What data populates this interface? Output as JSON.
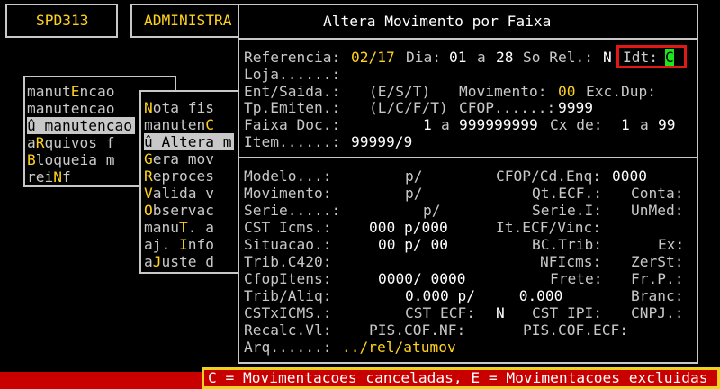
{
  "top_boxes": {
    "program": "SPD313",
    "menu_title": "ADMINISTRA"
  },
  "menu1": {
    "items": [
      {
        "pre": "manut",
        "hot": "E",
        "post": "ncao"
      },
      {
        "pre": "manutencao",
        "hot": "",
        "post": ""
      },
      {
        "pre": "û manutencao",
        "hot": "",
        "post": "",
        "selected": true
      },
      {
        "pre": "a",
        "hot": "R",
        "post": "quivos f"
      },
      {
        "pre": "",
        "hot": "B",
        "post": "loqueia m"
      },
      {
        "pre": "rei",
        "hot": "N",
        "post": "f"
      }
    ]
  },
  "menu2": {
    "items": [
      {
        "pre": "",
        "hot": "N",
        "post": "ota fis"
      },
      {
        "pre": "manuten",
        "hot": "C",
        "post": ""
      },
      {
        "pre": "û Altera m",
        "hot": "",
        "post": "",
        "selected": true
      },
      {
        "pre": "",
        "hot": "G",
        "post": "era mov"
      },
      {
        "pre": "",
        "hot": "R",
        "post": "eproces"
      },
      {
        "pre": "",
        "hot": "V",
        "post": "alida v"
      },
      {
        "pre": "",
        "hot": "O",
        "post": "bservac"
      },
      {
        "pre": "manu",
        "hot": "T",
        "post": ". a"
      },
      {
        "pre": "aj. ",
        "hot": "I",
        "post": "nfo"
      },
      {
        "pre": "a",
        "hot": "J",
        "post": "uste d"
      }
    ]
  },
  "dialog": {
    "title": "Altera Movimento por Faixa",
    "referencia_label": "Referencia:",
    "referencia_value": "02/17",
    "dia_label": "Dia:",
    "dia_from": "01",
    "a1": "a",
    "dia_to": "28",
    "so_rel_label": "So Rel.:",
    "so_rel_value": "N",
    "idt_label": "Idt:",
    "idt_value": "C",
    "loja_label": "Loja......:",
    "ent_saida_label": "Ent/Saida.:",
    "ent_saida_hint": "(E/S/T)",
    "movimento_label": "Movimento:",
    "movimento_value": "00",
    "exc_dup_label": "Exc.Dup:",
    "tp_emiten_label": "Tp.Emiten.:",
    "tp_emiten_hint": "(L/C/F/T)",
    "cfop_label": "CFOP......:",
    "cfop_value": "9999",
    "faixa_doc_label": "Faixa Doc.:",
    "faixa_from": "1",
    "a2": "a",
    "faixa_to": "999999999",
    "cx_de_label": "Cx de:",
    "cx_from": "1",
    "a3": "a",
    "cx_to": "99",
    "item_label": "Item......:",
    "item_value": "99999/9",
    "lower": {
      "modelo_label": "Modelo...:",
      "modelo_value": "p/",
      "cfop_cd_enq_label": "CFOP/Cd.Enq:",
      "cfop_cd_enq_value": "0000",
      "movimento_label": "Movimento:",
      "movimento_value": "p/",
      "qt_ecf_label": "Qt.ECF.:",
      "conta_label": "Conta:",
      "serie_label": "Serie.....:",
      "serie_value": "p/",
      "serie_i_label": "Serie.I:",
      "unmed_label": "UnMed:",
      "cst_icms_label": "CST Icms.:",
      "cst_icms_value": "000 p/000",
      "it_ecf_vinc_label": "It.ECF/Vinc:",
      "situacao_label": "Situacao.:",
      "situacao_value": "00 p/ 00",
      "bc_trib_label": "BC.Trib:",
      "ex_label": "Ex:",
      "trib_c420_label": "Trib.C420:",
      "nficms_label": "NFIcms:",
      "zerst_label": "ZerSt:",
      "cfopitens_label": "CfopItens:",
      "cfopitens_value": "0000/ 0000",
      "frete_label": "Frete:",
      "frp_label": "Fr.P.:",
      "trib_aliq_label": "Trib/Aliq:",
      "trib_aliq_value": "0.000 p/     0.000",
      "branc_label": "Branc:",
      "cstxicms_label": "CSTxICMS.:",
      "cst_ecf_label": "CST ECF:",
      "cst_ecf_value": "N",
      "cst_ipi_label": "CST IPI:",
      "cnpj_label": "CNPJ.:",
      "recalc_label": "Recalc.Vl:",
      "pis_cof_nf_label": "PIS.COF.NF:",
      "pis_cof_ecf_label": "PIS.COF.ECF:",
      "arq_label": "Arq......:",
      "arq_value": "../rel/atumov"
    }
  },
  "status": {
    "message": "C = Movimentacoes canceladas, E = Movimentacoes excluidas"
  },
  "colors": {
    "highlight": "#ffd21e",
    "cursor": "#1ee61e",
    "statusbar": "#c80000",
    "idt_border": "#e01818"
  }
}
